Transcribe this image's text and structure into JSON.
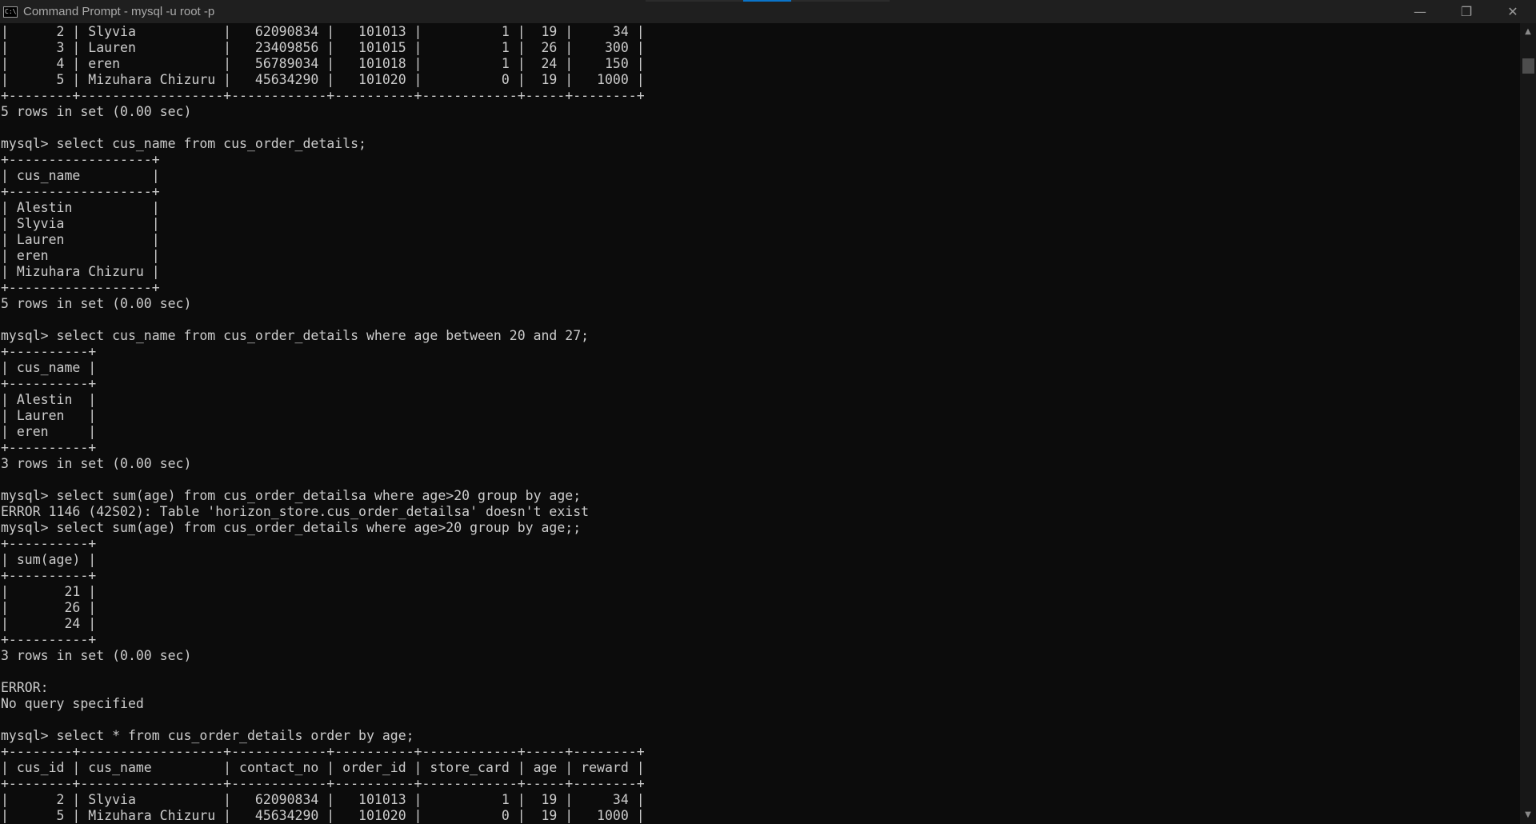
{
  "window": {
    "title": "Command Prompt - mysql  -u root -p",
    "icon": "cmd-icon",
    "controls": {
      "minimize": "—",
      "maximize": "❐",
      "close": "✕"
    }
  },
  "scrollbar": {
    "up": "▲",
    "down": "▼"
  },
  "console": {
    "lines": [
      "|      2 | Slyvia           |   62090834 |   101013 |          1 |  19 |     34 |",
      "|      3 | Lauren           |   23409856 |   101015 |          1 |  26 |    300 |",
      "|      4 | eren             |   56789034 |   101018 |          1 |  24 |    150 |",
      "|      5 | Mizuhara Chizuru |   45634290 |   101020 |          0 |  19 |   1000 |",
      "+--------+------------------+------------+----------+------------+-----+--------+",
      "5 rows in set (0.00 sec)",
      "",
      "mysql> select cus_name from cus_order_details;",
      "+------------------+",
      "| cus_name         |",
      "+------------------+",
      "| Alestin          |",
      "| Slyvia           |",
      "| Lauren           |",
      "| eren             |",
      "| Mizuhara Chizuru |",
      "+------------------+",
      "5 rows in set (0.00 sec)",
      "",
      "mysql> select cus_name from cus_order_details where age between 20 and 27;",
      "+----------+",
      "| cus_name |",
      "+----------+",
      "| Alestin  |",
      "| Lauren   |",
      "| eren     |",
      "+----------+",
      "3 rows in set (0.00 sec)",
      "",
      "mysql> select sum(age) from cus_order_detailsa where age>20 group by age;",
      "ERROR 1146 (42S02): Table 'horizon_store.cus_order_detailsa' doesn't exist",
      "mysql> select sum(age) from cus_order_details where age>20 group by age;;",
      "+----------+",
      "| sum(age) |",
      "+----------+",
      "|       21 |",
      "|       26 |",
      "|       24 |",
      "+----------+",
      "3 rows in set (0.00 sec)",
      "",
      "ERROR:",
      "No query specified",
      "",
      "mysql> select * from cus_order_details order by age;",
      "+--------+------------------+------------+----------+------------+-----+--------+",
      "| cus_id | cus_name         | contact_no | order_id | store_card | age | reward |",
      "+--------+------------------+------------+----------+------------+-----+--------+",
      "|      2 | Slyvia           |   62090834 |   101013 |          1 |  19 |     34 |",
      "|      5 | Mizuhara Chizuru |   45634290 |   101020 |          0 |  19 |   1000 |"
    ]
  }
}
